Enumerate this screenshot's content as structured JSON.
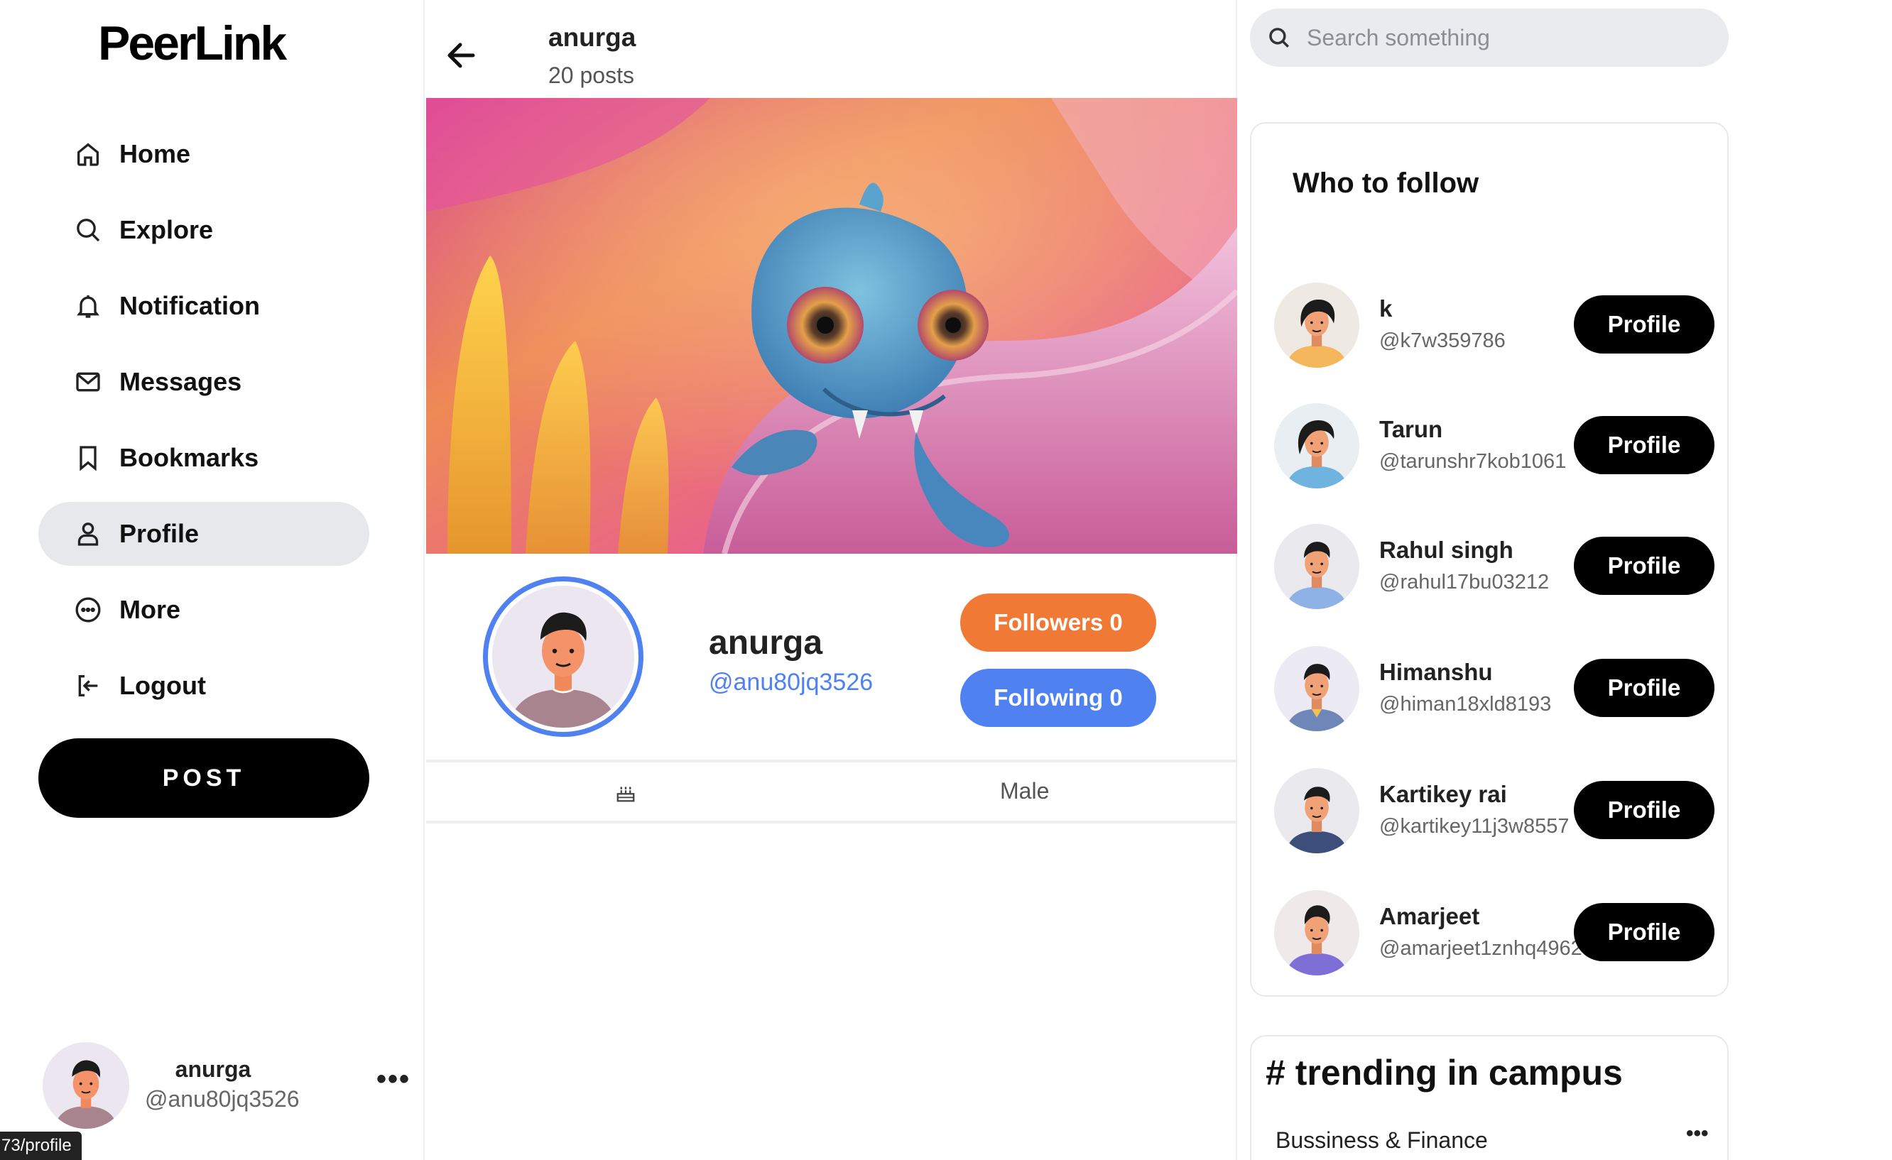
{
  "app": {
    "logo": "PeerLink"
  },
  "sidebar": {
    "nav": [
      {
        "label": "Home",
        "icon": "home-icon"
      },
      {
        "label": "Explore",
        "icon": "search-icon"
      },
      {
        "label": "Notification",
        "icon": "bell-icon"
      },
      {
        "label": "Messages",
        "icon": "mail-icon"
      },
      {
        "label": "Bookmarks",
        "icon": "bookmark-icon"
      },
      {
        "label": "Profile",
        "icon": "user-icon",
        "active": true
      },
      {
        "label": "More",
        "icon": "more-circle-icon"
      },
      {
        "label": "Logout",
        "icon": "logout-icon"
      }
    ],
    "post_label": "POST",
    "account": {
      "name": "anurga",
      "handle": "@anu80jq3526",
      "more": "•••"
    },
    "url_tooltip": "73/profile"
  },
  "header": {
    "name": "anurga",
    "posts": "20 posts"
  },
  "profile": {
    "name": "anurga",
    "handle": "@anu80jq3526",
    "followers_label": "Followers 0",
    "following_label": "Following 0",
    "gender": "Male"
  },
  "search": {
    "placeholder": "Search something"
  },
  "who_to_follow": {
    "title": "Who to follow",
    "button_label": "Profile",
    "users": [
      {
        "name": "k",
        "handle": "@k7w359786"
      },
      {
        "name": "Tarun",
        "handle": "@tarunshr7kob1061"
      },
      {
        "name": "Rahul singh",
        "handle": "@rahul17bu03212"
      },
      {
        "name": "Himanshu",
        "handle": "@himan18xld8193"
      },
      {
        "name": "Kartikey rai",
        "handle": "@kartikey11j3w8557"
      },
      {
        "name": "Amarjeet",
        "handle": "@amarjeet1znhq4962"
      }
    ]
  },
  "trending": {
    "title": "# trending in campus",
    "items": [
      {
        "label": "Bussiness & Finance",
        "more": "•••"
      }
    ]
  },
  "colors": {
    "followers_button": "#f07a35",
    "following_button": "#4f82f0",
    "handle_link": "#4f82f0",
    "active_nav_bg": "#e7e8eb"
  }
}
